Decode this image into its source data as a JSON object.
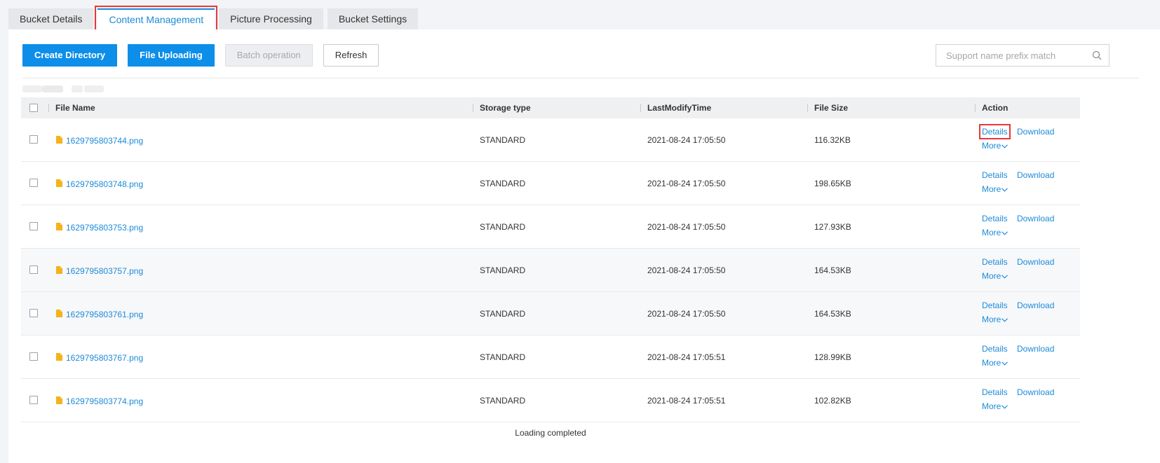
{
  "tabs": [
    {
      "label": "Bucket Details",
      "active": false
    },
    {
      "label": "Content Management",
      "active": true
    },
    {
      "label": "Picture Processing",
      "active": false
    },
    {
      "label": "Bucket Settings",
      "active": false
    }
  ],
  "toolbar": {
    "create_directory": "Create Directory",
    "file_uploading": "File Uploading",
    "batch_operation": "Batch operation",
    "refresh": "Refresh"
  },
  "search": {
    "placeholder": "Support name prefix match",
    "icon": "search-icon"
  },
  "table": {
    "columns": [
      "File Name",
      "Storage type",
      "LastModifyTime",
      "File Size",
      "Action"
    ],
    "rows": [
      {
        "name": "1629795803744.png",
        "storage": "STANDARD",
        "time": "2021-08-24 17:05:50",
        "size": "116.32KB"
      },
      {
        "name": "1629795803748.png",
        "storage": "STANDARD",
        "time": "2021-08-24 17:05:50",
        "size": "198.65KB"
      },
      {
        "name": "1629795803753.png",
        "storage": "STANDARD",
        "time": "2021-08-24 17:05:50",
        "size": "127.93KB"
      },
      {
        "name": "1629795803757.png",
        "storage": "STANDARD",
        "time": "2021-08-24 17:05:50",
        "size": "164.53KB"
      },
      {
        "name": "1629795803761.png",
        "storage": "STANDARD",
        "time": "2021-08-24 17:05:50",
        "size": "164.53KB"
      },
      {
        "name": "1629795803767.png",
        "storage": "STANDARD",
        "time": "2021-08-24 17:05:51",
        "size": "128.99KB"
      },
      {
        "name": "1629795803774.png",
        "storage": "STANDARD",
        "time": "2021-08-24 17:05:51",
        "size": "102.82KB"
      }
    ],
    "actions": {
      "details": "Details",
      "download": "Download",
      "more": "More"
    }
  },
  "footer": {
    "status": "Loading completed"
  },
  "colors": {
    "accent": "#1d8ad8",
    "primary_button": "#0d8ee9",
    "highlight_box": "#e8383b",
    "file_icon": "#f5b21b"
  }
}
